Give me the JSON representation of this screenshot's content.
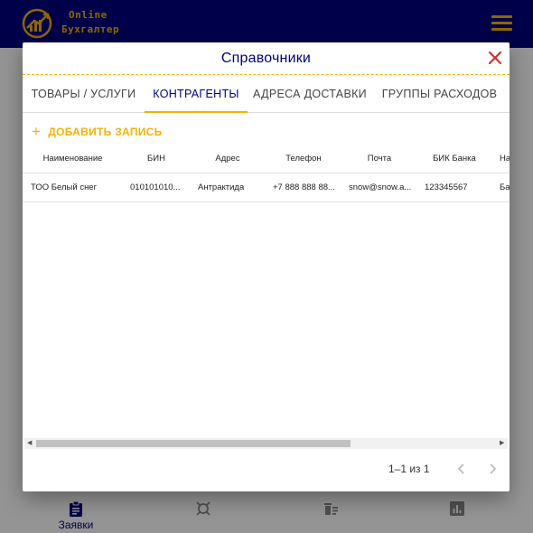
{
  "app": {
    "logo_line1": "Online",
    "logo_line2": "Бухгалтер",
    "brand_color": "#000080",
    "accent_color": "#f3b300"
  },
  "bottom_nav": [
    {
      "label": "Заявки",
      "icon": "clipboard-icon"
    },
    {
      "label": "",
      "icon": "target-icon"
    },
    {
      "label": "",
      "icon": "delete-list-icon"
    },
    {
      "label": "",
      "icon": "bar-chart-icon"
    }
  ],
  "dialog": {
    "title": "Справочники",
    "close_icon": "close-icon",
    "tabs": [
      {
        "label": "ТОВАРЫ / УСЛУГИ",
        "active": false
      },
      {
        "label": "КОНТРАГЕНТЫ",
        "active": true
      },
      {
        "label": "АДРЕСА ДОСТАВКИ",
        "active": false
      },
      {
        "label": "ГРУППЫ РАСХОДОВ",
        "active": false
      }
    ],
    "add_button": {
      "icon": "plus-icon",
      "label": "ДОБАВИТЬ ЗАПИСЬ"
    },
    "table": {
      "columns": [
        "Наименование",
        "БИН",
        "Адрес",
        "Телефон",
        "Почта",
        "БИК Банка",
        "На"
      ],
      "rows": [
        [
          "ТОО Белый снег",
          "010101010...",
          "Антрактида",
          "+7 888 888 88...",
          "snow@snow.a...",
          "123345567",
          "Ба"
        ]
      ]
    },
    "pagination": {
      "info": "1–1 из 1",
      "prev_icon": "chevron-left-icon",
      "next_icon": "chevron-right-icon"
    }
  }
}
